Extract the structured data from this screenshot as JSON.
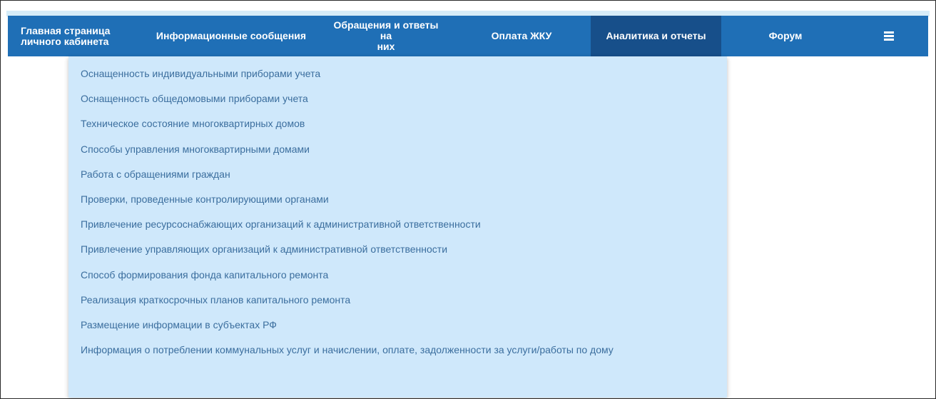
{
  "nav": {
    "items": [
      {
        "label_line1": "Главная страница",
        "label_line2": "личного кабинета"
      },
      {
        "label": "Информационные сообщения"
      },
      {
        "label_line1": "Обращения и ответы на",
        "label_line2": "них"
      },
      {
        "label": "Оплата ЖКУ"
      },
      {
        "label": "Аналитика и отчеты",
        "active": true
      },
      {
        "label": "Форум"
      }
    ],
    "menu_icon": "hamburger-menu-icon"
  },
  "dropdown": {
    "items": [
      "Оснащенность индивидуальными приборами учета",
      "Оснащенность общедомовыми приборами учета",
      "Техническое состояние многоквартирных домов",
      "Способы управления многоквартирными домами",
      "Работа с обращениями граждан",
      "Проверки, проведенные контролирующими органами",
      "Привлечение ресурсоснабжающих организаций к административной ответственности",
      "Привлечение управляющих организаций к административной ответственности",
      "Способ формирования фонда капитального ремонта",
      "Реализация краткосрочных планов капитального ремонта",
      "Размещение информации в субъектах РФ",
      "Информация о потреблении коммунальных услуг и начислении, оплате, задолженности за услуги/работы по дому"
    ]
  },
  "colors": {
    "nav_bg": "#1f6fb6",
    "nav_active_bg": "#174f8a",
    "dropdown_bg": "#cfe8fb",
    "dropdown_text": "#3b6e9e"
  }
}
